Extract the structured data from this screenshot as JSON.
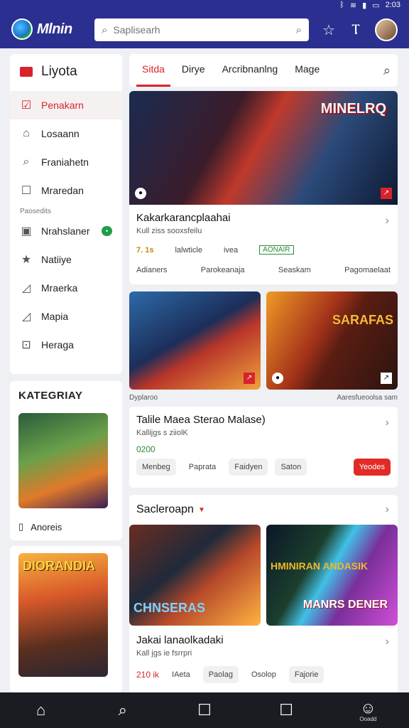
{
  "status": {
    "icons": [
      "bluetooth-icon",
      "wifi-icon",
      "signal-icon",
      "battery-icon"
    ],
    "time": "2:03"
  },
  "header": {
    "brand": "Mlnin",
    "search_placeholder": "Saplisearh"
  },
  "sidebar": {
    "title": "Liyota",
    "items": [
      {
        "label": "Penakarn",
        "icon": "checkbox-icon"
      },
      {
        "label": "Losaann",
        "icon": "home-icon"
      },
      {
        "label": "Franiahetn",
        "icon": "search-icon"
      },
      {
        "label": "Mraredan",
        "icon": "square-icon"
      }
    ],
    "section_label": "Paosedits",
    "items2": [
      {
        "label": "Nrahslaner",
        "badge": "•",
        "icon": "tv-icon"
      },
      {
        "label": "Natiiye",
        "icon": "star-icon"
      },
      {
        "label": "Mraerka",
        "icon": "chart-icon"
      },
      {
        "label": "Mapia",
        "icon": "chart-icon"
      },
      {
        "label": "Heraga",
        "icon": "tag-icon"
      }
    ]
  },
  "categories": {
    "title": "KATEGRIAY",
    "row_label": "Anoreis",
    "badge2_label": "DIORANDIA"
  },
  "tabs": [
    {
      "label": "Sitda"
    },
    {
      "label": "Dirye"
    },
    {
      "label": "Arcribnanlng"
    },
    {
      "label": "Mage"
    }
  ],
  "card1": {
    "hero_brand": "MINELRQ",
    "title": "Kakarkarancplaahai",
    "subtitle": "Kull ziss sooxsfeilu",
    "meta1": "7. 1s",
    "meta2": "lalwticle",
    "meta3": "ivea",
    "meta4": "AONAIR",
    "links": [
      "Adianers",
      "Parokeanaja",
      "Seaskam",
      "Pagomaelaat"
    ]
  },
  "duo": {
    "caption_left": "Dyplaroo",
    "caption_right": "Aaresfueoolsa sam",
    "label_b": "SARAFAS"
  },
  "card2": {
    "title": "Talile Maea Sterao Malase)",
    "subtitle": "Kallijgs s  ziiolK",
    "price": "0200",
    "buttons": [
      "Menbeg",
      "Paprata",
      "Faidyen",
      "Saton",
      "Yeodes"
    ]
  },
  "section3": {
    "heading": "Sacleroapn",
    "label_c": "CHNSERAS",
    "label_d": "HMINIRAN ANDASIK",
    "label_d2": "MANRS DENER",
    "title": "Jakai lanaolkadaki",
    "subtitle": "Kall jgs ie  fsrrpri",
    "price": "210 ik",
    "buttons": [
      "IAeta",
      "Paolag",
      "Osolop",
      "Fajorie"
    ]
  },
  "bottomnav": [
    {
      "icon": "home-icon"
    },
    {
      "icon": "search-icon"
    },
    {
      "icon": "square-icon"
    },
    {
      "icon": "square-icon"
    },
    {
      "icon": "profile-icon",
      "label": "Ooadd"
    }
  ]
}
